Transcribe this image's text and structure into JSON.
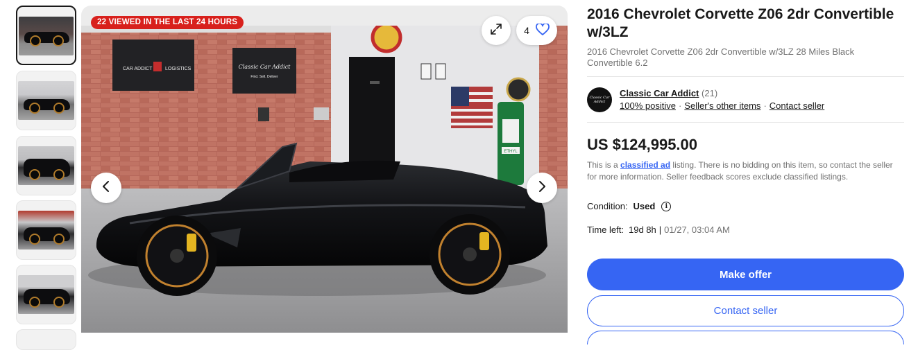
{
  "gallery": {
    "thumbnails": [
      {
        "label": "photo 1",
        "selected": true
      },
      {
        "label": "photo 2",
        "selected": false
      },
      {
        "label": "photo 3",
        "selected": false
      },
      {
        "label": "photo 4",
        "selected": false
      },
      {
        "label": "photo 5",
        "selected": false
      }
    ],
    "badge": "22 VIEWED IN THE LAST 24 HOURS",
    "watch_count": "4",
    "icons": {
      "expand": "expand-icon",
      "heart": "heart-icon",
      "prev": "chevron-left-icon",
      "next": "chevron-right-icon"
    },
    "photo_signs": {
      "sign1": "CAR ADDICT",
      "sign1b": "LOGISTICS",
      "sign2": "Classic Car Addict",
      "sign2b": "Find. Sell. Deliver",
      "pump": "ETHYL"
    }
  },
  "listing": {
    "title": "2016 Chevrolet Corvette Z06 2dr Convertible w/3LZ",
    "subtitle": "2016 Chevrolet Corvette Z06 2dr Convertible w/3LZ 28 Miles Black Convertible 6.2",
    "seller": {
      "name": "Classic Car Addict",
      "count": "(21)",
      "positive": "100% positive",
      "other_items": "Seller's other items",
      "contact": "Contact seller",
      "logo_text": "Classic Car Addict"
    },
    "price": "US $124,995.00",
    "note_pre": "This is a ",
    "note_link": "classified ad",
    "note_post": " listing. There is no bidding on this item, so contact the seller for more information. Seller feedback scores exclude classified listings.",
    "condition_label": "Condition:",
    "condition_value": "Used",
    "time_label": "Time left:",
    "time_value": "19d 8h",
    "time_sep": "|",
    "time_date": "01/27, 03:04 AM",
    "primary_button": "Make offer",
    "secondary_button": "Contact seller"
  },
  "colors": {
    "accent": "#3665f3",
    "badge": "#d8201c",
    "muted": "#707070"
  }
}
